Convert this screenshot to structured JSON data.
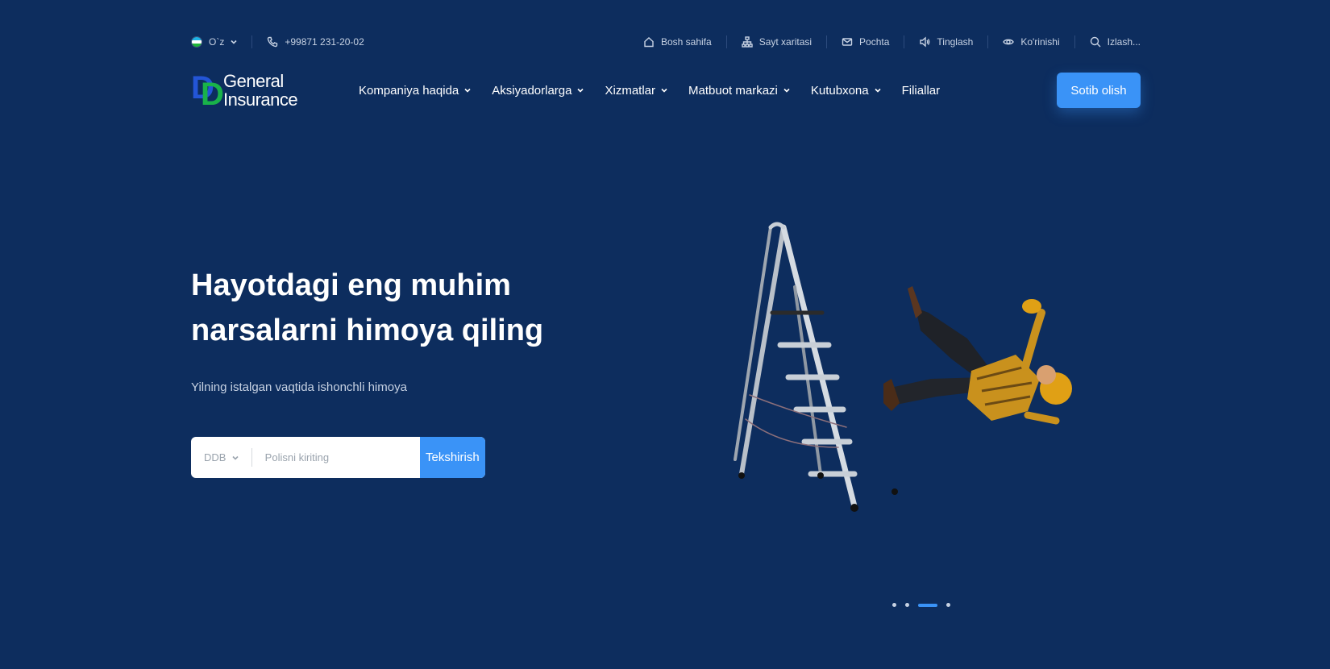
{
  "topbar": {
    "language": "O`z",
    "phone": "+99871 231-20-02",
    "links": [
      {
        "label": "Bosh sahifa",
        "icon": "home-icon"
      },
      {
        "label": "Sayt xaritasi",
        "icon": "sitemap-icon"
      },
      {
        "label": "Pochta",
        "icon": "mail-icon"
      },
      {
        "label": "Tinglash",
        "icon": "speaker-icon"
      },
      {
        "label": "Ko'rinishi",
        "icon": "eye-icon"
      },
      {
        "label": "Izlash...",
        "icon": "search-icon"
      }
    ]
  },
  "logo": {
    "line1": "General",
    "line2": "Insurance",
    "mark": "DD"
  },
  "nav": {
    "items": [
      {
        "label": "Kompaniya haqida",
        "dropdown": true
      },
      {
        "label": "Aksiyadorlarga",
        "dropdown": true
      },
      {
        "label": "Xizmatlar",
        "dropdown": true
      },
      {
        "label": "Matbuot markazi",
        "dropdown": true
      },
      {
        "label": "Kutubxona",
        "dropdown": true
      },
      {
        "label": "Filiallar",
        "dropdown": false
      }
    ],
    "cta": "Sotib olish"
  },
  "hero": {
    "title": "Hayotdagi eng muhim narsalarni himoya qiling",
    "subtitle": "Yilning istalgan vaqtida ishonchli himoya",
    "search": {
      "select_value": "DDB",
      "placeholder": "Polisni kiriting",
      "button": "Tekshirish"
    }
  },
  "slider": {
    "count": 4,
    "active": 3
  },
  "colors": {
    "background": "#0d2d5e",
    "accent": "#3a93f7",
    "logo_blue": "#2355d6",
    "logo_green": "#19b24a"
  }
}
